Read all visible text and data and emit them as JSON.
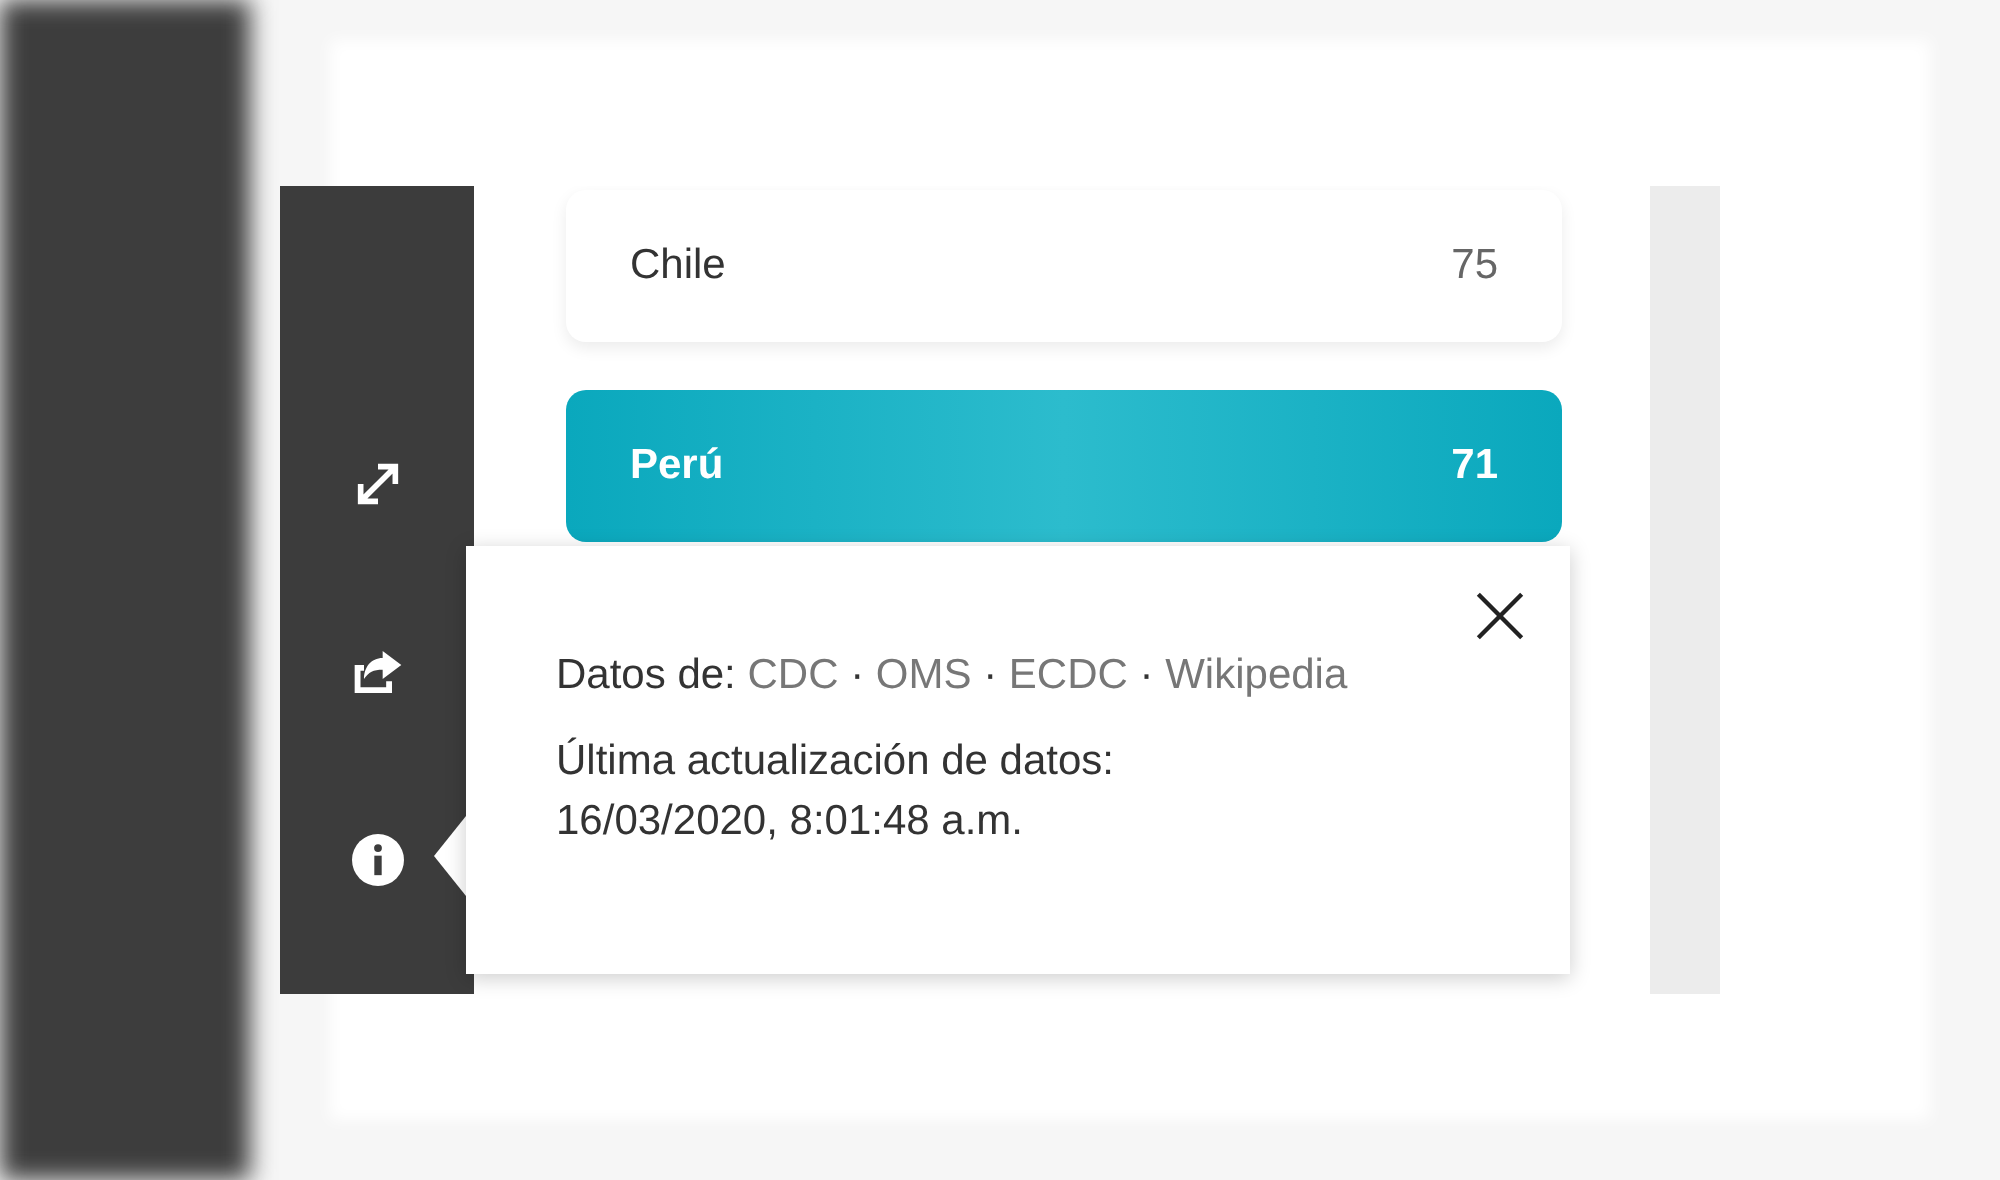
{
  "countries": [
    {
      "name": "Chile",
      "count": "75",
      "selected": false
    },
    {
      "name": "Perú",
      "count": "71",
      "selected": true
    }
  ],
  "info_popover": {
    "sources_label": "Datos de:",
    "sources": [
      "CDC",
      "OMS",
      "ECDC",
      "Wikipedia"
    ],
    "separator": "·",
    "updated_label": "Última actualización de datos:",
    "updated_value": "16/03/2020, 8:01:48 a.m."
  }
}
